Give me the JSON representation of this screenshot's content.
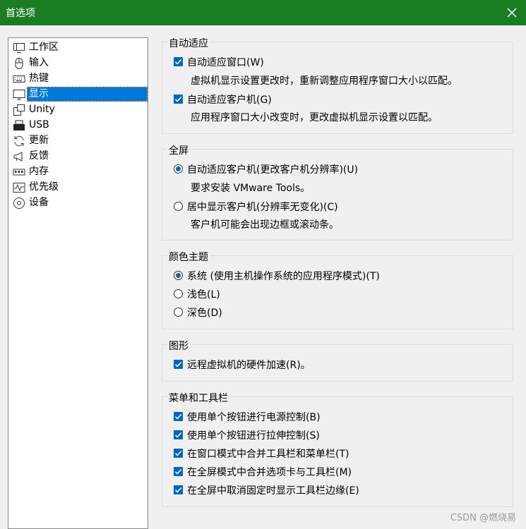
{
  "window": {
    "title": "首选项"
  },
  "nav": {
    "items": [
      {
        "label": "工作区",
        "icon": "workspace-icon"
      },
      {
        "label": "输入",
        "icon": "mouse-icon"
      },
      {
        "label": "热键",
        "icon": "keyboard-icon"
      },
      {
        "label": "显示",
        "icon": "monitor-icon",
        "selected": true
      },
      {
        "label": "Unity",
        "icon": "unity-icon"
      },
      {
        "label": "USB",
        "icon": "usb-icon"
      },
      {
        "label": "更新",
        "icon": "refresh-icon"
      },
      {
        "label": "反馈",
        "icon": "megaphone-icon"
      },
      {
        "label": "内存",
        "icon": "memory-icon"
      },
      {
        "label": "优先级",
        "icon": "priority-icon"
      },
      {
        "label": "设备",
        "icon": "device-icon"
      }
    ]
  },
  "autofit": {
    "title": "自动适应",
    "window_check": {
      "label": "自动适应窗口(W)",
      "checked": true
    },
    "window_desc": "虚拟机显示设置更改时，重新调整应用程序窗口大小以匹配。",
    "guest_check": {
      "label": "自动适应客户机(G)",
      "checked": true
    },
    "guest_desc": "应用程序窗口大小改变时，更改虚拟机显示设置以匹配。"
  },
  "fullscreen": {
    "title": "全屏",
    "opt1": {
      "label": "自动适应客户机(更改客户机分辨率)(U)",
      "selected": true
    },
    "opt1_desc": "要求安装 VMware Tools。",
    "opt2": {
      "label": "居中显示客户机(分辨率无变化)(C)",
      "selected": false
    },
    "opt2_desc": "客户机可能会出现边框或滚动条。"
  },
  "theme": {
    "title": "颜色主题",
    "opt1": {
      "label": "系统 (使用主机操作系统的应用程序模式)(T)",
      "selected": true
    },
    "opt2": {
      "label": "浅色(L)",
      "selected": false
    },
    "opt3": {
      "label": "深色(D)",
      "selected": false
    }
  },
  "graphics": {
    "title": "图形",
    "accel": {
      "label": "远程虚拟机的硬件加速(R)。",
      "checked": true
    }
  },
  "menu_toolbar": {
    "title": "菜单和工具栏",
    "items": [
      {
        "label": "使用单个按钮进行电源控制(B)",
        "checked": true
      },
      {
        "label": "使用单个按钮进行拉伸控制(S)",
        "checked": true
      },
      {
        "label": "在窗口模式中合并工具栏和菜单栏(T)",
        "checked": true
      },
      {
        "label": "在全屏模式中合并选项卡与工具栏(M)",
        "checked": true
      },
      {
        "label": "在全屏中取消固定时显示工具栏边缘(E)",
        "checked": true
      }
    ]
  },
  "watermark": "CSDN @燃烧易",
  "colors": {
    "titlebar": "#1b7d22",
    "accent": "#0067c0",
    "selection": "#0078d7"
  }
}
